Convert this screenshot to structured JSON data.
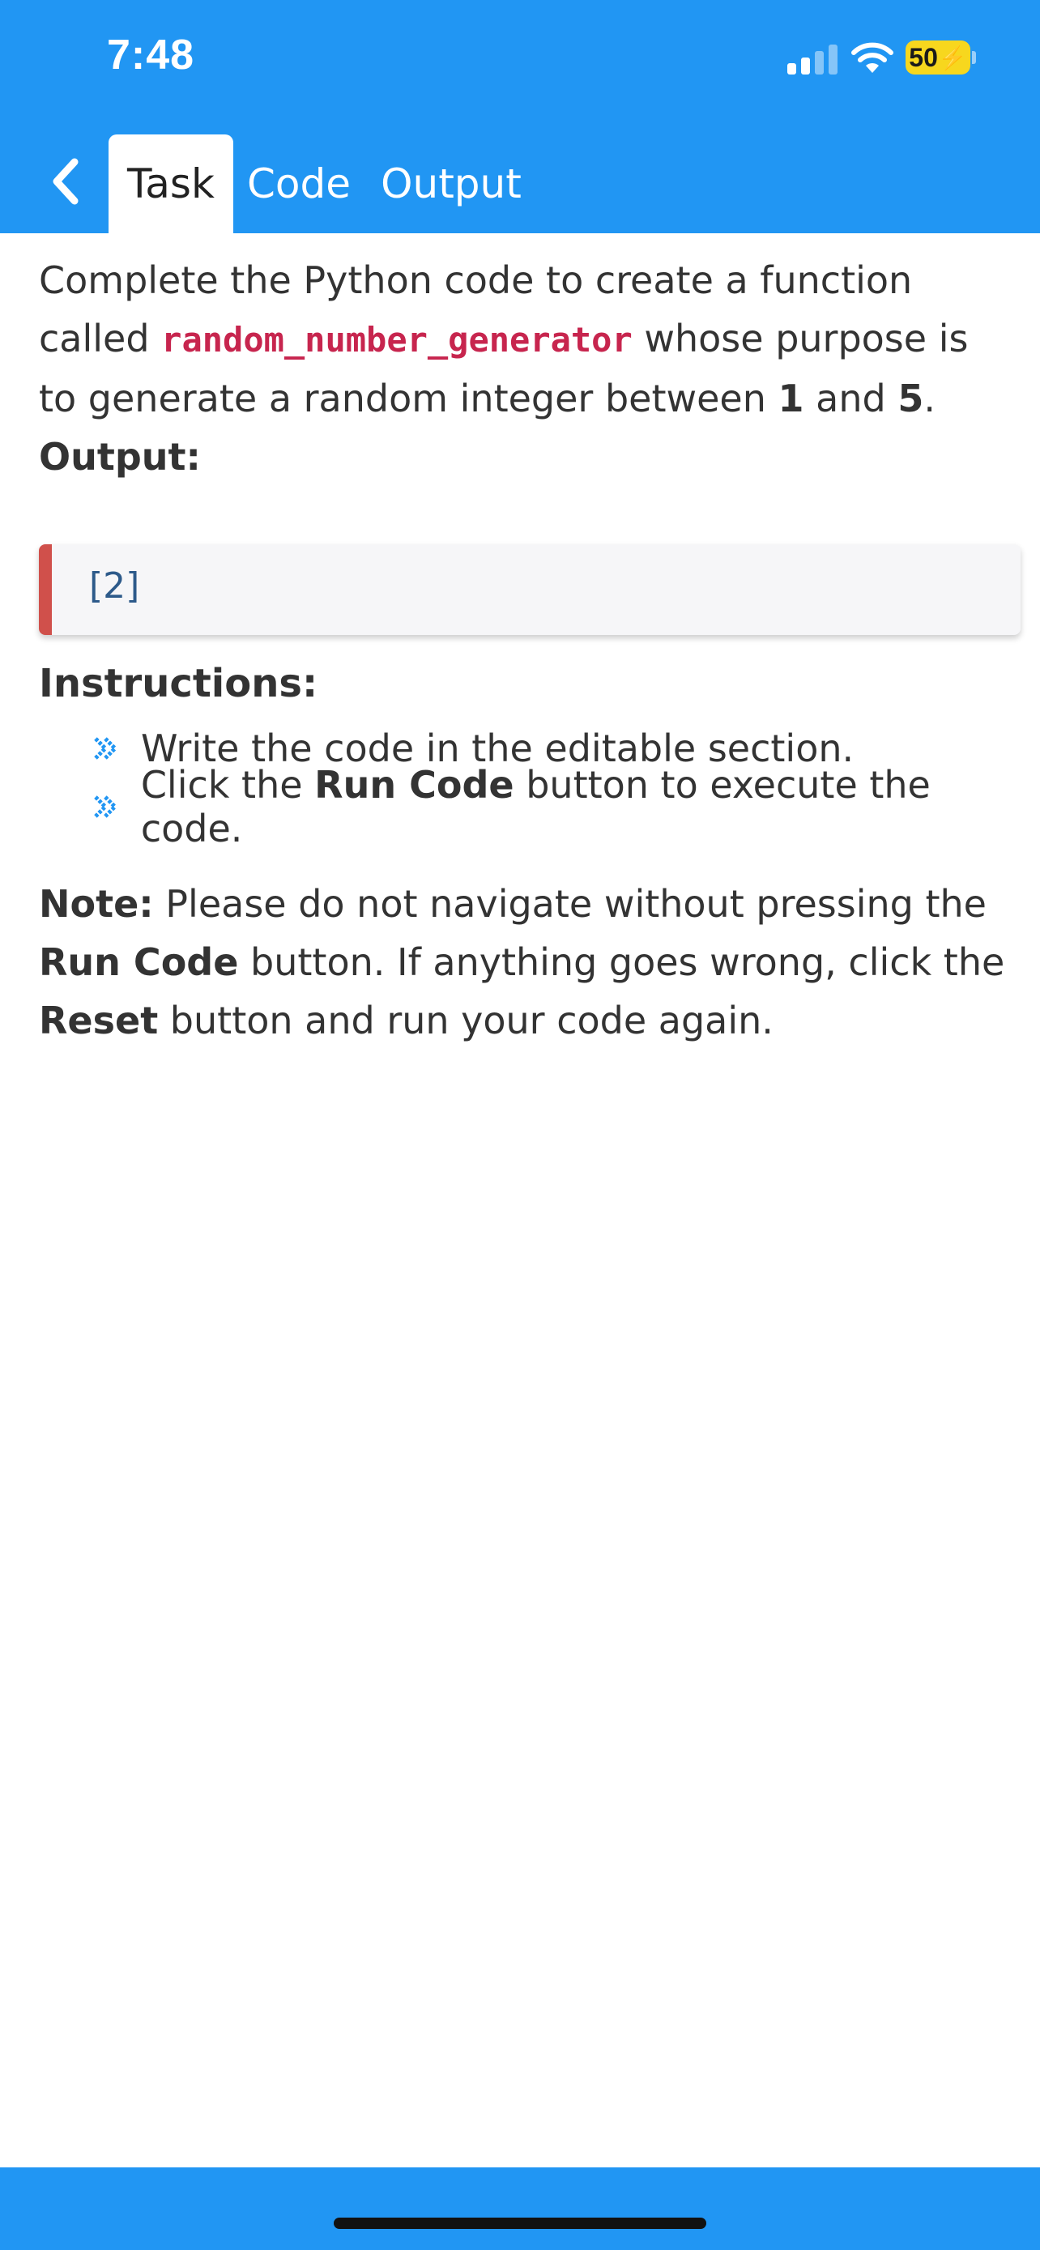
{
  "status_bar": {
    "time": "7:48",
    "battery": "50"
  },
  "tabs": [
    {
      "label": "Task",
      "active": true
    },
    {
      "label": "Code",
      "active": false
    },
    {
      "label": "Output",
      "active": false
    }
  ],
  "task": {
    "intro_1": "Complete the Python code to create a function called",
    "function_name": "random_number_generator",
    "intro_2": " whose purpose is to generate a random integer between ",
    "num_low": "1",
    "and_text": " and ",
    "num_high": "5",
    "period": ".",
    "output_label": "Output:",
    "output_value": "[2]"
  },
  "instructions": {
    "title": "Instructions:",
    "item1": "Write the code in the editable section.",
    "item2_pre": "Click the ",
    "item2_bold": "Run Code",
    "item2_post": " button to execute the code."
  },
  "note": {
    "label": "Note:",
    "text1": " Please do not navigate without pressing the ",
    "run_code": "Run Code",
    "text2": " button. If anything goes wrong, click the ",
    "reset": "Reset",
    "text3": " button and run your code again."
  },
  "colors": {
    "primary": "#2196F3",
    "function_name": "#C7254E",
    "output_border": "#D0504B",
    "battery": "#F7D71E"
  }
}
